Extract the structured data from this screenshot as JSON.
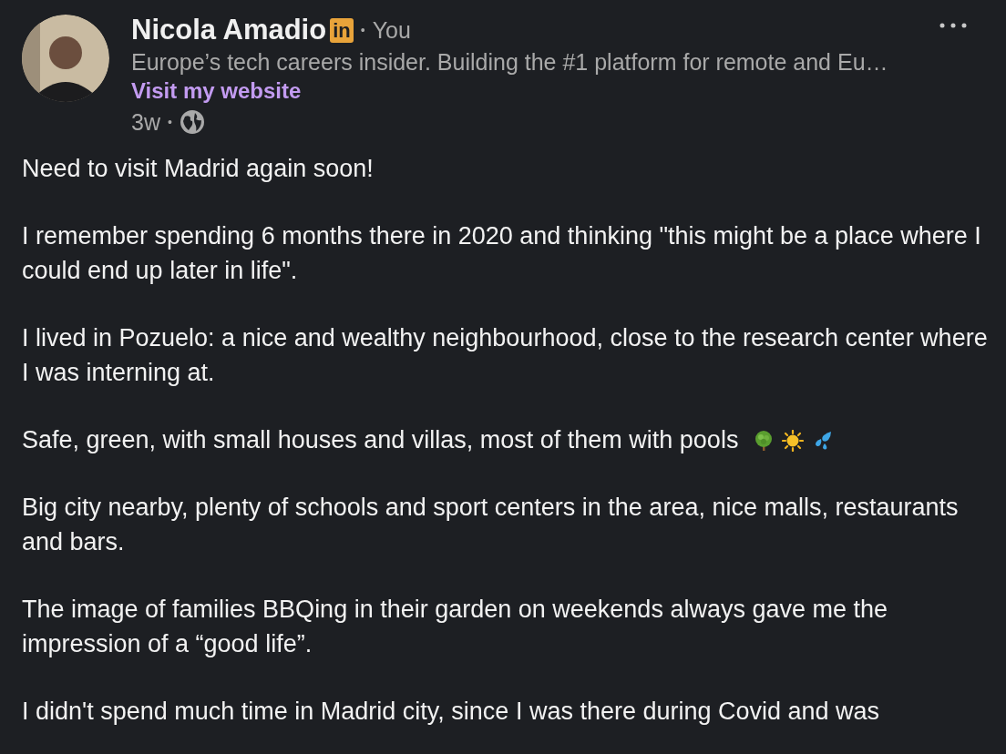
{
  "author": {
    "name": "Nicola Amadio",
    "badge": "in",
    "relation": "You",
    "headline": "Europe’s tech careers insider. Building the #1 platform for remote and Eu…",
    "link": "Visit my website",
    "age": "3w",
    "separator": "•"
  },
  "paragraphs": [
    {
      "text": "Need to visit Madrid again soon!"
    },
    {
      "text": "I remember spending 6 months there in 2020 and thinking \"this might be a place where I could end up later in life\"."
    },
    {
      "text": "I lived in Pozuelo: a nice and wealthy neighbourhood, close to the research center where I was interning at."
    },
    {
      "text": "Safe, green, with small houses and villas, most of them with pools",
      "emojis": [
        {
          "kind": "tree"
        },
        {
          "kind": "sun"
        },
        {
          "kind": "droplets"
        }
      ]
    },
    {
      "text": "Big city nearby, plenty of schools and sport centers in the area, nice malls, restaurants and bars."
    },
    {
      "text": "The image of families BBQing in their garden on weekends always gave me the impression of a “good life”."
    },
    {
      "text": "I didn't spend much time in Madrid city, since I was there during Covid and was"
    }
  ]
}
